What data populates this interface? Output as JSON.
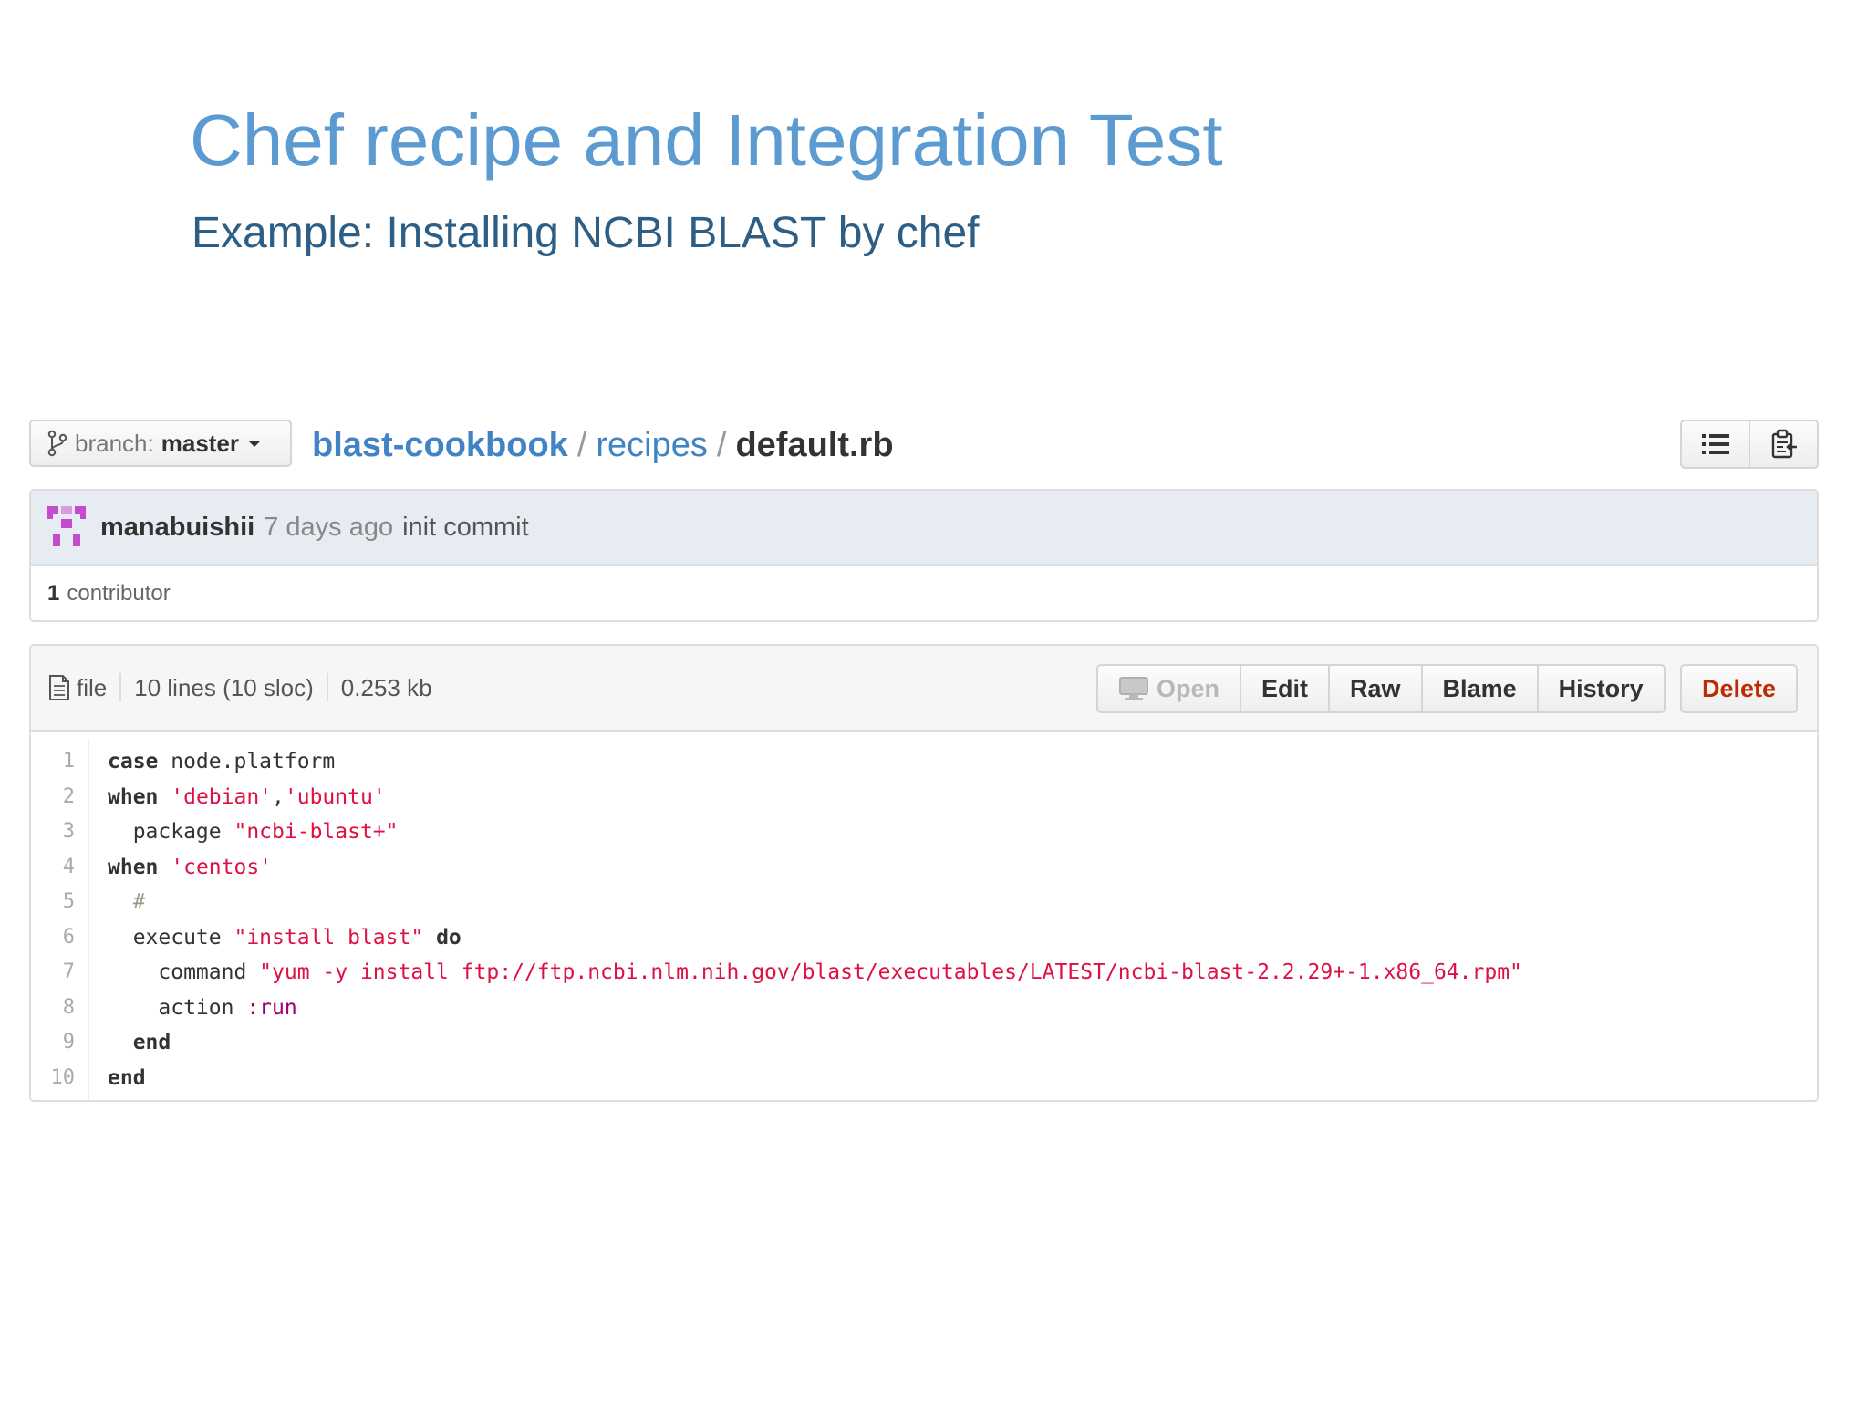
{
  "slide": {
    "title": "Chef recipe and Integration Test",
    "subtitle": "Example: Installing NCBI BLAST by chef"
  },
  "branch": {
    "prefix": "branch:",
    "name": "master"
  },
  "breadcrumb": {
    "repo": "blast-cookbook",
    "separator": "/",
    "dir": "recipes",
    "file": "default.rb"
  },
  "commit": {
    "author": "manabuishii",
    "time": "7 days ago",
    "message": "init commit",
    "contributor_count": "1",
    "contributor_label": "contributor"
  },
  "file_info": {
    "label": "file",
    "lines": "10 lines (10 sloc)",
    "size": "0.253 kb"
  },
  "file_actions": {
    "open": "Open",
    "edit": "Edit",
    "raw": "Raw",
    "blame": "Blame",
    "history": "History",
    "delete": "Delete"
  },
  "code": {
    "line_numbers": [
      "1",
      "2",
      "3",
      "4",
      "5",
      "6",
      "7",
      "8",
      "9",
      "10"
    ],
    "lines": [
      [
        {
          "t": "kw",
          "v": "case"
        },
        {
          "t": "plain",
          "v": " node.platform"
        }
      ],
      [
        {
          "t": "kw",
          "v": "when"
        },
        {
          "t": "plain",
          "v": " "
        },
        {
          "t": "str",
          "v": "'debian'"
        },
        {
          "t": "plain",
          "v": ","
        },
        {
          "t": "str",
          "v": "'ubuntu'"
        }
      ],
      [
        {
          "t": "plain",
          "v": "  package "
        },
        {
          "t": "str",
          "v": "\"ncbi-blast+\""
        }
      ],
      [
        {
          "t": "kw",
          "v": "when"
        },
        {
          "t": "plain",
          "v": " "
        },
        {
          "t": "str",
          "v": "'centos'"
        }
      ],
      [
        {
          "t": "plain",
          "v": "  "
        },
        {
          "t": "cmt",
          "v": "#"
        }
      ],
      [
        {
          "t": "plain",
          "v": "  execute "
        },
        {
          "t": "str",
          "v": "\"install blast\""
        },
        {
          "t": "plain",
          "v": " "
        },
        {
          "t": "kw",
          "v": "do"
        }
      ],
      [
        {
          "t": "plain",
          "v": "    command "
        },
        {
          "t": "str",
          "v": "\"yum -y install ftp://ftp.ncbi.nlm.nih.gov/blast/executables/LATEST/ncbi-blast-2.2.29+-1.x86_64.rpm\""
        }
      ],
      [
        {
          "t": "plain",
          "v": "    action "
        },
        {
          "t": "sym",
          "v": ":run"
        }
      ],
      [
        {
          "t": "plain",
          "v": "  "
        },
        {
          "t": "kw",
          "v": "end"
        }
      ],
      [
        {
          "t": "kw",
          "v": "end"
        }
      ]
    ]
  },
  "icons": {
    "branch": "branch-icon",
    "avatar": "avatar-identicon",
    "file": "file-text-icon",
    "list": "list-icon",
    "clipboard": "clipboard-icon",
    "open": "desktop-icon"
  },
  "colors": {
    "title": "#5b9bd1",
    "subtitle": "#2d5f86",
    "link": "#4183c4",
    "string": "#dd1144",
    "delete": "#bd2c00",
    "avatar": "#c54bce"
  }
}
